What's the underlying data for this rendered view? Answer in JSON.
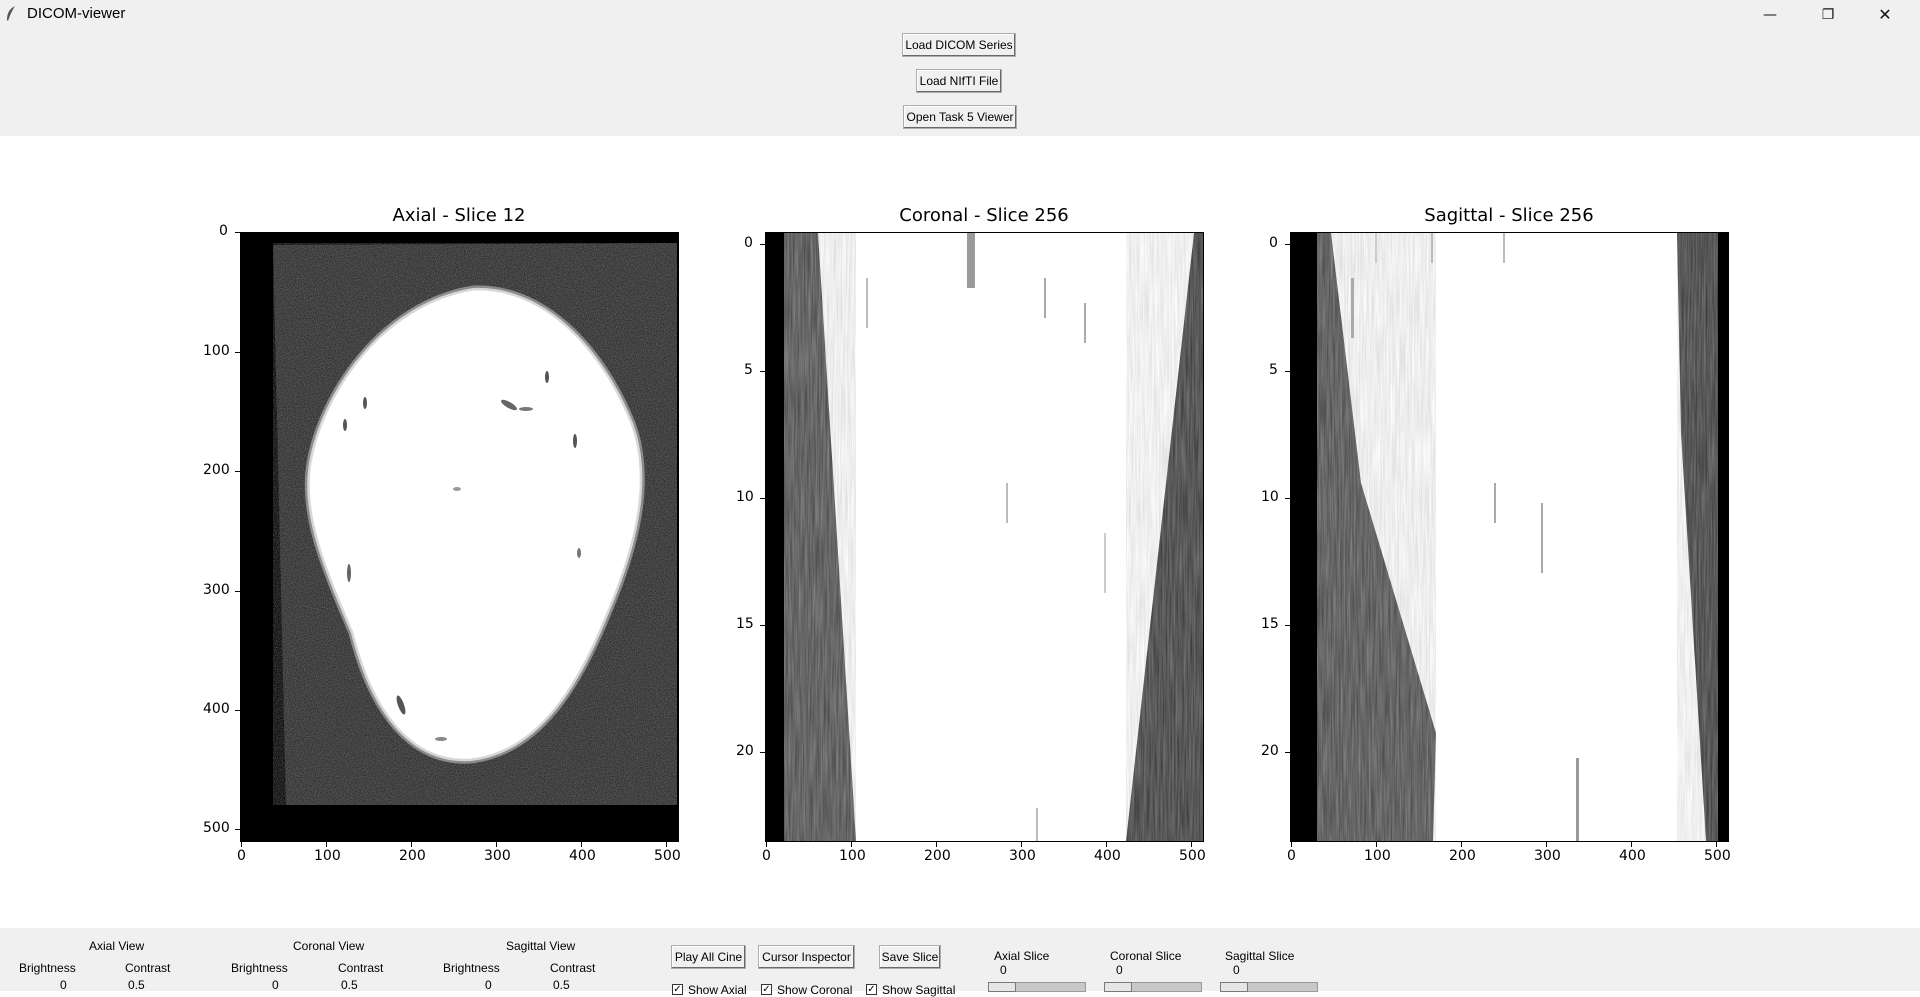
{
  "window": {
    "title": "DICOM-viewer",
    "app_icon": "feather-icon",
    "controls": {
      "minimize": "—",
      "maximize": "❐",
      "close": "✕"
    }
  },
  "toolbar": {
    "load_dicom": "Load DICOM Series",
    "load_nifti": "Load NIfTI File",
    "open_task5": "Open Task 5 Viewer"
  },
  "views": {
    "axial": {
      "title": "Axial - Slice 12",
      "x_ticks": [
        "0",
        "100",
        "200",
        "300",
        "400",
        "500"
      ],
      "y_ticks": [
        "0",
        "100",
        "200",
        "300",
        "400",
        "500"
      ]
    },
    "coronal": {
      "title": "Coronal - Slice 256",
      "x_ticks": [
        "0",
        "100",
        "200",
        "300",
        "400",
        "500"
      ],
      "y_ticks": [
        "0",
        "5",
        "10",
        "15",
        "20"
      ]
    },
    "sagittal": {
      "title": "Sagittal - Slice 256",
      "x_ticks": [
        "0",
        "100",
        "200",
        "300",
        "400",
        "500"
      ],
      "y_ticks": [
        "0",
        "5",
        "10",
        "15",
        "20"
      ]
    }
  },
  "controls": {
    "axial_view": {
      "label": "Axial View",
      "brightness_label": "Brightness",
      "brightness_value": "0",
      "contrast_label": "Contrast",
      "contrast_value": "0.5"
    },
    "coronal_view": {
      "label": "Coronal View",
      "brightness_label": "Brightness",
      "brightness_value": "0",
      "contrast_label": "Contrast",
      "contrast_value": "0.5"
    },
    "sagittal_view": {
      "label": "Sagittal View",
      "brightness_label": "Brightness",
      "brightness_value": "0",
      "contrast_label": "Contrast",
      "contrast_value": "0.5"
    },
    "play_all_cine": "Play All Cine",
    "cursor_inspector": "Cursor Inspector",
    "save_slice": "Save Slice",
    "show_axial": "Show Axial",
    "show_coronal": "Show Coronal",
    "show_sagittal": "Show Sagittal",
    "axial_slice": {
      "label": "Axial Slice",
      "value": "0"
    },
    "coronal_slice": {
      "label": "Coronal Slice",
      "value": "0"
    },
    "sagittal_slice": {
      "label": "Sagittal Slice",
      "value": "0"
    }
  }
}
